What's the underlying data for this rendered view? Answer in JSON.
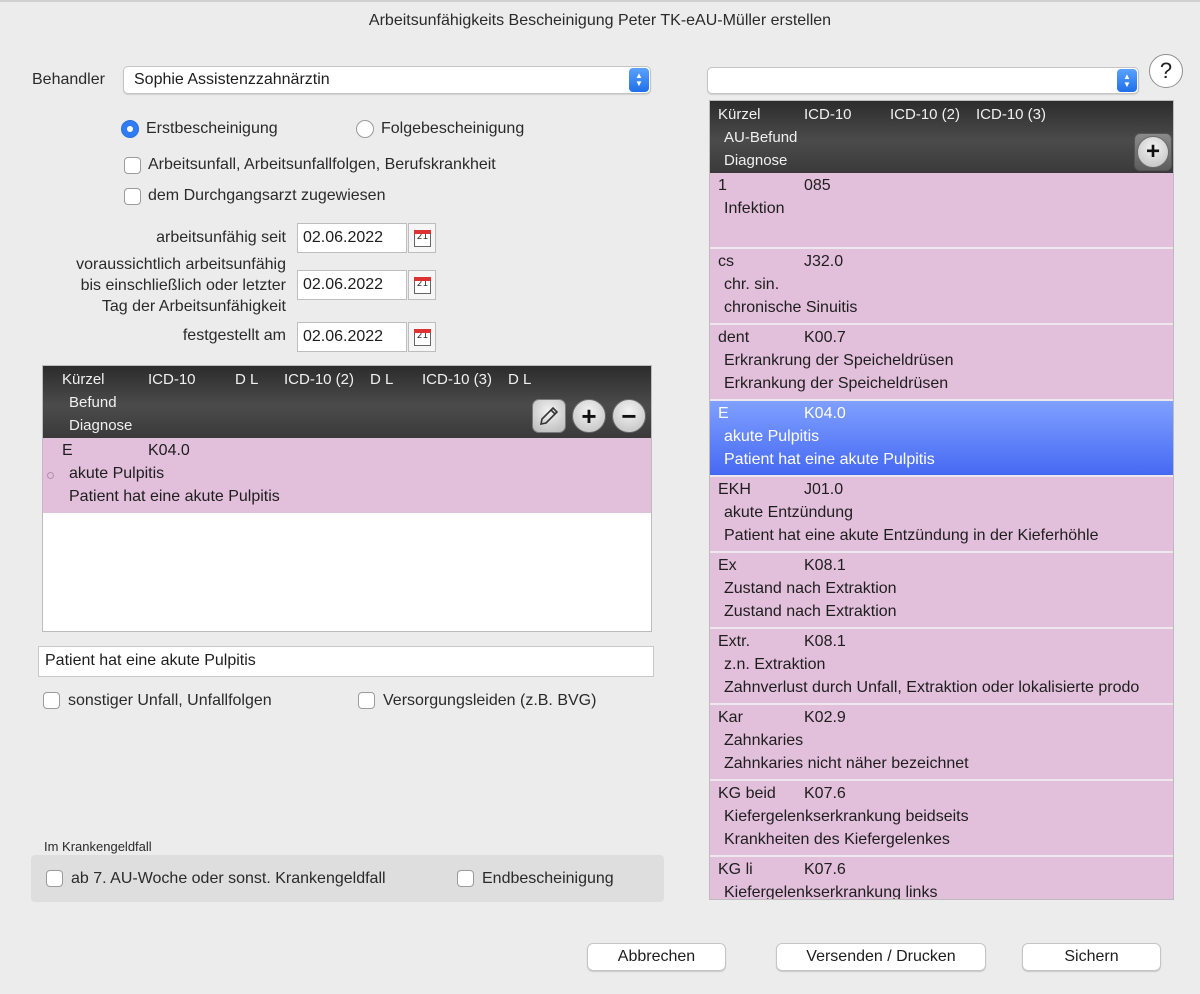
{
  "window": {
    "title": "Arbeitsunfähigkeits Bescheinigung Peter TK-eAU-Müller erstellen"
  },
  "behandler": {
    "label": "Behandler",
    "value": "Sophie Assistenzzahnärztin"
  },
  "right_popup": {
    "value": ""
  },
  "help": {
    "label": "?"
  },
  "radios": {
    "erst": {
      "label": "Erstbescheinigung",
      "selected": true
    },
    "folge": {
      "label": "Folgebescheinigung",
      "selected": false
    }
  },
  "checks": {
    "arbeitsunfall": "Arbeitsunfall, Arbeitsunfallfolgen, Berufskrankheit",
    "durchgangsarzt": "dem Durchgangsarzt zugewiesen",
    "sonstiger_unfall": "sonstiger Unfall, Unfallfolgen",
    "versorgungsleiden": "Versorgungsleiden (z.B. BVG)",
    "krankengeld": "ab 7. AU-Woche oder sonst. Krankengeldfall",
    "endbescheinigung": "Endbescheinigung"
  },
  "dates": {
    "seit": {
      "label": "arbeitsunfähig seit",
      "value": "02.06.2022"
    },
    "bis": {
      "label_lines": [
        "voraussichtlich arbeitsunfähig",
        "bis einschließlich oder letzter",
        "Tag der Arbeitsunfähigkeit"
      ],
      "value": "02.06.2022"
    },
    "festgestellt": {
      "label": "festgestellt am",
      "value": "02.06.2022"
    },
    "cal_glyph": "21"
  },
  "left_table": {
    "headers": {
      "kuerzel": "Kürzel",
      "icd": "ICD-10",
      "dl1": "D L",
      "icd2": "ICD-10 (2)",
      "dl2": "D L",
      "icd3": "ICD-10 (3)",
      "dl3": "D L",
      "befund": "Befund",
      "diagnose": "Diagnose"
    },
    "row": {
      "kuerzel": "E",
      "icd": "K04.0",
      "befund": "akute Pulpitis",
      "diagnose": "Patient hat eine akute Pulpitis"
    }
  },
  "diagnosis_text": "Patient hat eine akute Pulpitis",
  "krankengeld_section": {
    "label": "Im Krankengeldfall"
  },
  "right_table": {
    "headers": {
      "kuerzel": "Kürzel",
      "icd": "ICD-10",
      "icd2": "ICD-10 (2)",
      "icd3": "ICD-10 (3)",
      "befund": "AU-Befund",
      "diagnose": "Diagnose"
    },
    "rows": [
      {
        "kuerzel": "1",
        "icd": "085",
        "befund": "Infektion",
        "diagnose": ""
      },
      {
        "kuerzel": "cs",
        "icd": "J32.0",
        "befund": "chr. sin.",
        "diagnose": "chronische Sinuitis"
      },
      {
        "kuerzel": "dent",
        "icd": "K00.7",
        "befund": "Erkrankrung der Speicheldrüsen",
        "diagnose": "Erkrankung der Speicheldrüsen"
      },
      {
        "kuerzel": "E",
        "icd": "K04.0",
        "befund": "akute Pulpitis",
        "diagnose": "Patient hat eine akute Pulpitis"
      },
      {
        "kuerzel": "EKH",
        "icd": "J01.0",
        "befund": "akute Entzündung",
        "diagnose": "Patient hat eine akute Entzündung in der Kieferhöhle"
      },
      {
        "kuerzel": "Ex",
        "icd": "K08.1",
        "befund": "Zustand nach Extraktion",
        "diagnose": "Zustand nach Extraktion"
      },
      {
        "kuerzel": "Extr.",
        "icd": "K08.1",
        "befund": "z.n. Extraktion",
        "diagnose": "Zahnverlust durch Unfall, Extraktion oder lokalisierte prodo"
      },
      {
        "kuerzel": "Kar",
        "icd": "K02.9",
        "befund": "Zahnkaries",
        "diagnose": "Zahnkaries nicht näher bezeichnet"
      },
      {
        "kuerzel": "KG beid",
        "icd": "K07.6",
        "befund": "Kiefergelenkserkrankung beidseits",
        "diagnose": "Krankheiten des Kiefergelenkes"
      },
      {
        "kuerzel": "KG li",
        "icd": "K07.6",
        "befund": "Kiefergelenkserkrankung links",
        "diagnose": ""
      }
    ]
  },
  "buttons": {
    "cancel": "Abbrechen",
    "send": "Versenden / Drucken",
    "save": "Sichern"
  }
}
